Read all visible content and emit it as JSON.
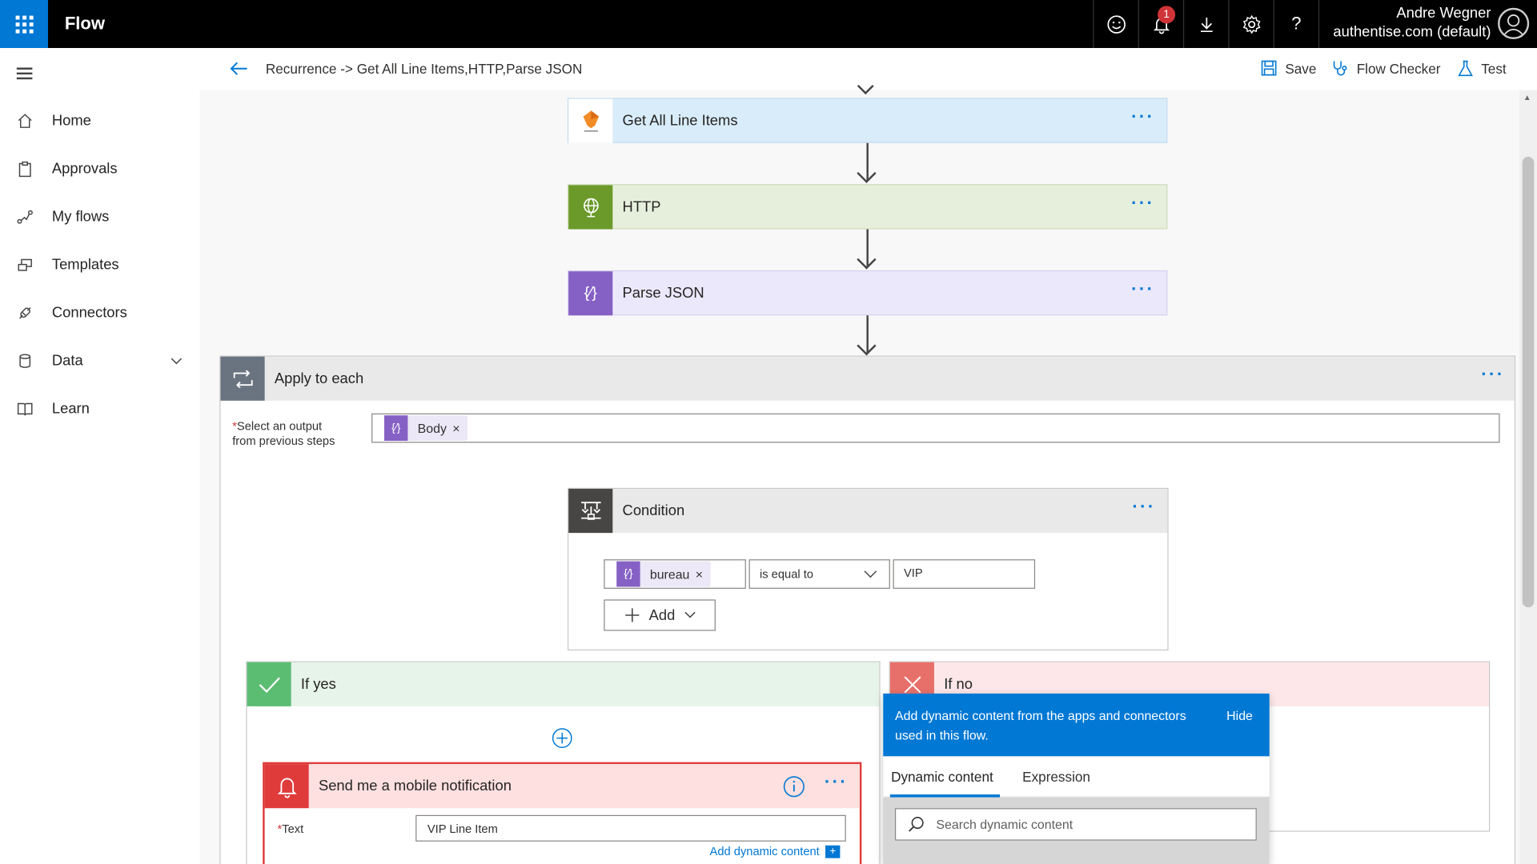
{
  "topbar": {
    "app_name": "Flow",
    "notification_count": "1",
    "help_label": "?",
    "user_name": "Andre Wegner",
    "user_tenant": "authentise.com (default)"
  },
  "nav": {
    "items": [
      {
        "label": "Home",
        "icon": "home-icon"
      },
      {
        "label": "Approvals",
        "icon": "approvals-icon"
      },
      {
        "label": "My flows",
        "icon": "flows-icon"
      },
      {
        "label": "Templates",
        "icon": "templates-icon"
      },
      {
        "label": "Connectors",
        "icon": "connectors-icon"
      },
      {
        "label": "Data",
        "icon": "data-icon"
      },
      {
        "label": "Learn",
        "icon": "learn-icon"
      }
    ]
  },
  "header": {
    "flow_title": "Recurrence -> Get All Line Items,HTTP,Parse JSON",
    "save_label": "Save",
    "flow_checker_label": "Flow Checker",
    "test_label": "Test"
  },
  "steps": {
    "get_all": "Get All Line Items",
    "http": "HTTP",
    "parse_json": "Parse JSON",
    "apply_each": "Apply to each",
    "select_output_label_1": "Select an output",
    "select_output_label_2": "from previous steps",
    "body_token": "Body",
    "condition": "Condition",
    "bureau_token": "bureau",
    "operator": "is equal to",
    "value": "VIP",
    "add_label": "Add",
    "if_yes": "If yes",
    "if_no": "If no",
    "notification_title": "Send me a mobile notification",
    "text_label": "Text",
    "text_value": "VIP Line Item",
    "add_dynamic": "Add dynamic content"
  },
  "dynamic_panel": {
    "info": "Add dynamic content from the apps and connectors used in this flow.",
    "hide": "Hide",
    "tab_dynamic": "Dynamic content",
    "tab_expression": "Expression",
    "search_placeholder": "Search dynamic content"
  },
  "colors": {
    "brand_blue": "#0078d4",
    "http_green": "#6b9a2a",
    "parse_purple": "#8661c5",
    "condition_dark": "#484644",
    "yes_green": "#5bbd72",
    "no_red": "#e8706a",
    "notify_red": "#e03b3b"
  }
}
